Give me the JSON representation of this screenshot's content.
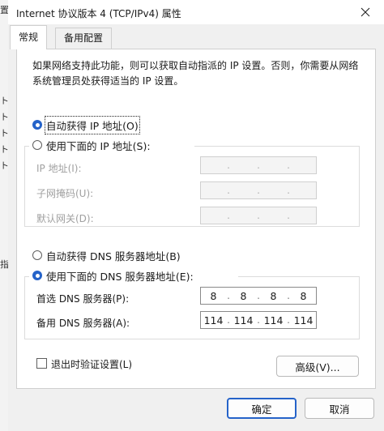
{
  "window": {
    "title": "Internet 协议版本 4 (TCP/IPv4) 属性"
  },
  "background_glyphs": [
    "置",
    "ト",
    "ト",
    "ト",
    "ト",
    "ト",
    "指"
  ],
  "tabs": [
    {
      "label": "常规",
      "active": true
    },
    {
      "label": "备用配置",
      "active": false
    }
  ],
  "description": "如果网络支持此功能，则可以获取自动指派的 IP 设置。否则，你需要从网络系统管理员处获得适当的 IP 设置。",
  "ip": {
    "auto_label": "自动获得 IP 地址(O)",
    "manual_label": "使用下面的 IP 地址(S):",
    "selected": "auto",
    "fields": [
      {
        "label": "IP 地址(I):",
        "octets": [
          "",
          "",
          "",
          ""
        ]
      },
      {
        "label": "子网掩码(U):",
        "octets": [
          "",
          "",
          "",
          ""
        ]
      },
      {
        "label": "默认网关(D):",
        "octets": [
          "",
          "",
          "",
          ""
        ]
      }
    ]
  },
  "dns": {
    "auto_label": "自动获得 DNS 服务器地址(B)",
    "manual_label": "使用下面的 DNS 服务器地址(E):",
    "selected": "manual",
    "fields": [
      {
        "label": "首选 DNS 服务器(P):",
        "octets": [
          "8",
          "8",
          "8",
          "8"
        ]
      },
      {
        "label": "备用 DNS 服务器(A):",
        "octets": [
          "114",
          "114",
          "114",
          "114"
        ]
      }
    ]
  },
  "validate_label": "退出时验证设置(L)",
  "advanced_label": "高级(V)...",
  "ok_label": "确定",
  "cancel_label": "取消",
  "colors": {
    "accent": "#2563c9",
    "dialog_bg": "#f0f0f0",
    "panel_bg": "#ffffff"
  }
}
